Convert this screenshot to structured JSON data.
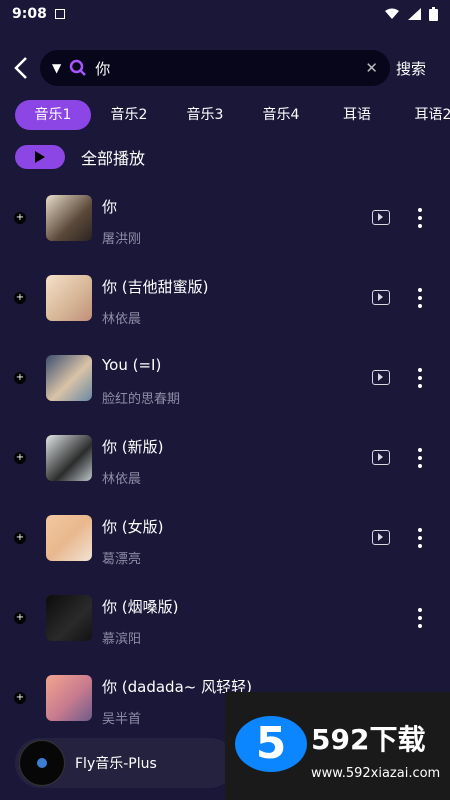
{
  "status": {
    "time": "9:08",
    "icons": [
      "wifi-icon",
      "signal-icon",
      "battery-icon"
    ]
  },
  "search": {
    "query": "你",
    "button_label": "搜索"
  },
  "tabs": [
    {
      "label": "音乐1",
      "active": true
    },
    {
      "label": "音乐2"
    },
    {
      "label": "音乐3"
    },
    {
      "label": "音乐4"
    },
    {
      "label": "耳语"
    },
    {
      "label": "耳语2"
    }
  ],
  "play_all": {
    "label": "全部播放"
  },
  "songs": [
    {
      "title": "你",
      "artist": "屠洪刚",
      "has_mv": true
    },
    {
      "title": "你 (吉他甜蜜版)",
      "artist": "林依晨",
      "has_mv": true
    },
    {
      "title": "You (=I)",
      "artist": "脸红的思春期",
      "has_mv": true
    },
    {
      "title": "你 (新版)",
      "artist": "林依晨",
      "has_mv": true
    },
    {
      "title": "你 (女版)",
      "artist": "葛漂亮",
      "has_mv": true
    },
    {
      "title": "你 (烟嗓版)",
      "artist": "慕滨阳",
      "has_mv": false
    },
    {
      "title": "你 (dadada~ 风轻轻)",
      "artist": "吴半首",
      "has_mv": false
    }
  ],
  "player": {
    "title": "Fly音乐-Plus"
  },
  "watermark": {
    "logo": "5",
    "title": "592下载",
    "url": "www.592xiazai.com"
  }
}
